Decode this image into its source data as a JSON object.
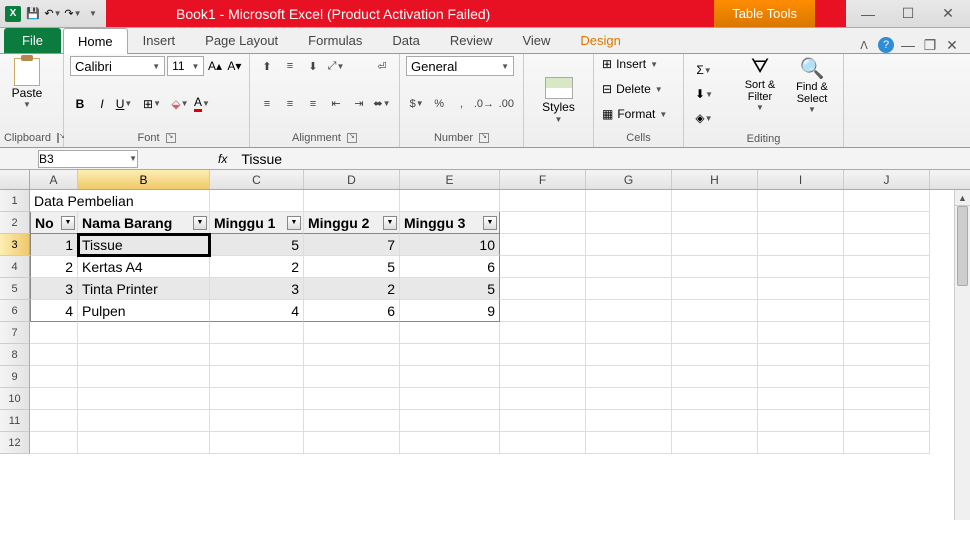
{
  "title": "Book1 - Microsoft Excel (Product Activation Failed)",
  "contextual_tab_group": "Table Tools",
  "tabs": {
    "file": "File",
    "home": "Home",
    "insert": "Insert",
    "page_layout": "Page Layout",
    "formulas": "Formulas",
    "data": "Data",
    "review": "Review",
    "view": "View",
    "design": "Design"
  },
  "ribbon": {
    "clipboard": {
      "paste": "Paste",
      "label": "Clipboard"
    },
    "font": {
      "name": "Calibri",
      "size": "11",
      "label": "Font",
      "bold": "B",
      "italic": "I",
      "underline": "U"
    },
    "alignment": {
      "label": "Alignment"
    },
    "number": {
      "format": "General",
      "label": "Number"
    },
    "styles": {
      "btn": "Styles"
    },
    "cells": {
      "insert": "Insert",
      "delete": "Delete",
      "format": "Format",
      "label": "Cells"
    },
    "editing": {
      "sort": "Sort & Filter",
      "find": "Find & Select",
      "label": "Editing"
    }
  },
  "namebox": "B3",
  "formula_bar": "Tissue",
  "columns": [
    "A",
    "B",
    "C",
    "D",
    "E",
    "F",
    "G",
    "H",
    "I",
    "J"
  ],
  "sheet_title": "Data Pembelian",
  "headers": [
    "No",
    "Nama Barang",
    "Minggu 1",
    "Minggu 2",
    "Minggu 3"
  ],
  "rows": [
    {
      "no": "1",
      "nama": "Tissue",
      "m1": "5",
      "m2": "7",
      "m3": "10"
    },
    {
      "no": "2",
      "nama": "Kertas A4",
      "m1": "2",
      "m2": "5",
      "m3": "6"
    },
    {
      "no": "3",
      "nama": "Tinta Printer",
      "m1": "3",
      "m2": "2",
      "m3": "5"
    },
    {
      "no": "4",
      "nama": "Pulpen",
      "m1": "4",
      "m2": "6",
      "m3": "9"
    }
  ],
  "chart_data": {
    "type": "table",
    "title": "Data Pembelian",
    "columns": [
      "No",
      "Nama Barang",
      "Minggu 1",
      "Minggu 2",
      "Minggu 3"
    ],
    "data": [
      [
        1,
        "Tissue",
        5,
        7,
        10
      ],
      [
        2,
        "Kertas A4",
        2,
        5,
        6
      ],
      [
        3,
        "Tinta Printer",
        3,
        2,
        5
      ],
      [
        4,
        "Pulpen",
        4,
        6,
        9
      ]
    ]
  }
}
